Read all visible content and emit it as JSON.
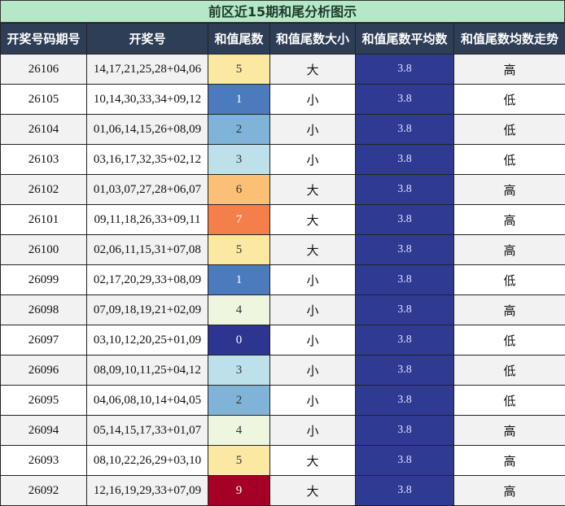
{
  "title": "前区近15期和尾分析图示",
  "headers": [
    "开奖号码期号",
    "开奖号",
    "和值尾数",
    "和值尾数大小",
    "和值尾数平均数",
    "和值尾数均数走势"
  ],
  "colors": {
    "0": "#2c3590",
    "1": "#4b7bbd",
    "2": "#7fb4d8",
    "3": "#bde1ea",
    "4": "#eef6df",
    "5": "#fbe9a3",
    "6": "#fbc076",
    "7": "#f47f4b",
    "9": "#a50026"
  },
  "rows": [
    {
      "period": "26106",
      "draw": "14,17,21,25,28+04,06",
      "tail": "5",
      "size": "大",
      "avg": "3.8",
      "trend": "高"
    },
    {
      "period": "26105",
      "draw": "10,14,30,33,34+09,12",
      "tail": "1",
      "size": "小",
      "avg": "3.8",
      "trend": "低"
    },
    {
      "period": "26104",
      "draw": "01,06,14,15,26+08,09",
      "tail": "2",
      "size": "小",
      "avg": "3.8",
      "trend": "低"
    },
    {
      "period": "26103",
      "draw": "03,16,17,32,35+02,12",
      "tail": "3",
      "size": "小",
      "avg": "3.8",
      "trend": "低"
    },
    {
      "period": "26102",
      "draw": "01,03,07,27,28+06,07",
      "tail": "6",
      "size": "大",
      "avg": "3.8",
      "trend": "高"
    },
    {
      "period": "26101",
      "draw": "09,11,18,26,33+09,11",
      "tail": "7",
      "size": "大",
      "avg": "3.8",
      "trend": "高"
    },
    {
      "period": "26100",
      "draw": "02,06,11,15,31+07,08",
      "tail": "5",
      "size": "大",
      "avg": "3.8",
      "trend": "高"
    },
    {
      "period": "26099",
      "draw": "02,17,20,29,33+08,09",
      "tail": "1",
      "size": "小",
      "avg": "3.8",
      "trend": "低"
    },
    {
      "period": "26098",
      "draw": "07,09,18,19,21+02,09",
      "tail": "4",
      "size": "小",
      "avg": "3.8",
      "trend": "高"
    },
    {
      "period": "26097",
      "draw": "03,10,12,20,25+01,09",
      "tail": "0",
      "size": "小",
      "avg": "3.8",
      "trend": "低"
    },
    {
      "period": "26096",
      "draw": "08,09,10,11,25+04,12",
      "tail": "3",
      "size": "小",
      "avg": "3.8",
      "trend": "低"
    },
    {
      "period": "26095",
      "draw": "04,06,08,10,14+04,05",
      "tail": "2",
      "size": "小",
      "avg": "3.8",
      "trend": "低"
    },
    {
      "period": "26094",
      "draw": "05,14,15,17,33+01,07",
      "tail": "4",
      "size": "小",
      "avg": "3.8",
      "trend": "高"
    },
    {
      "period": "26093",
      "draw": "08,10,22,26,29+03,10",
      "tail": "5",
      "size": "大",
      "avg": "3.8",
      "trend": "高"
    },
    {
      "period": "26092",
      "draw": "12,16,19,29,33+07,09",
      "tail": "9",
      "size": "大",
      "avg": "3.8",
      "trend": "高"
    }
  ]
}
